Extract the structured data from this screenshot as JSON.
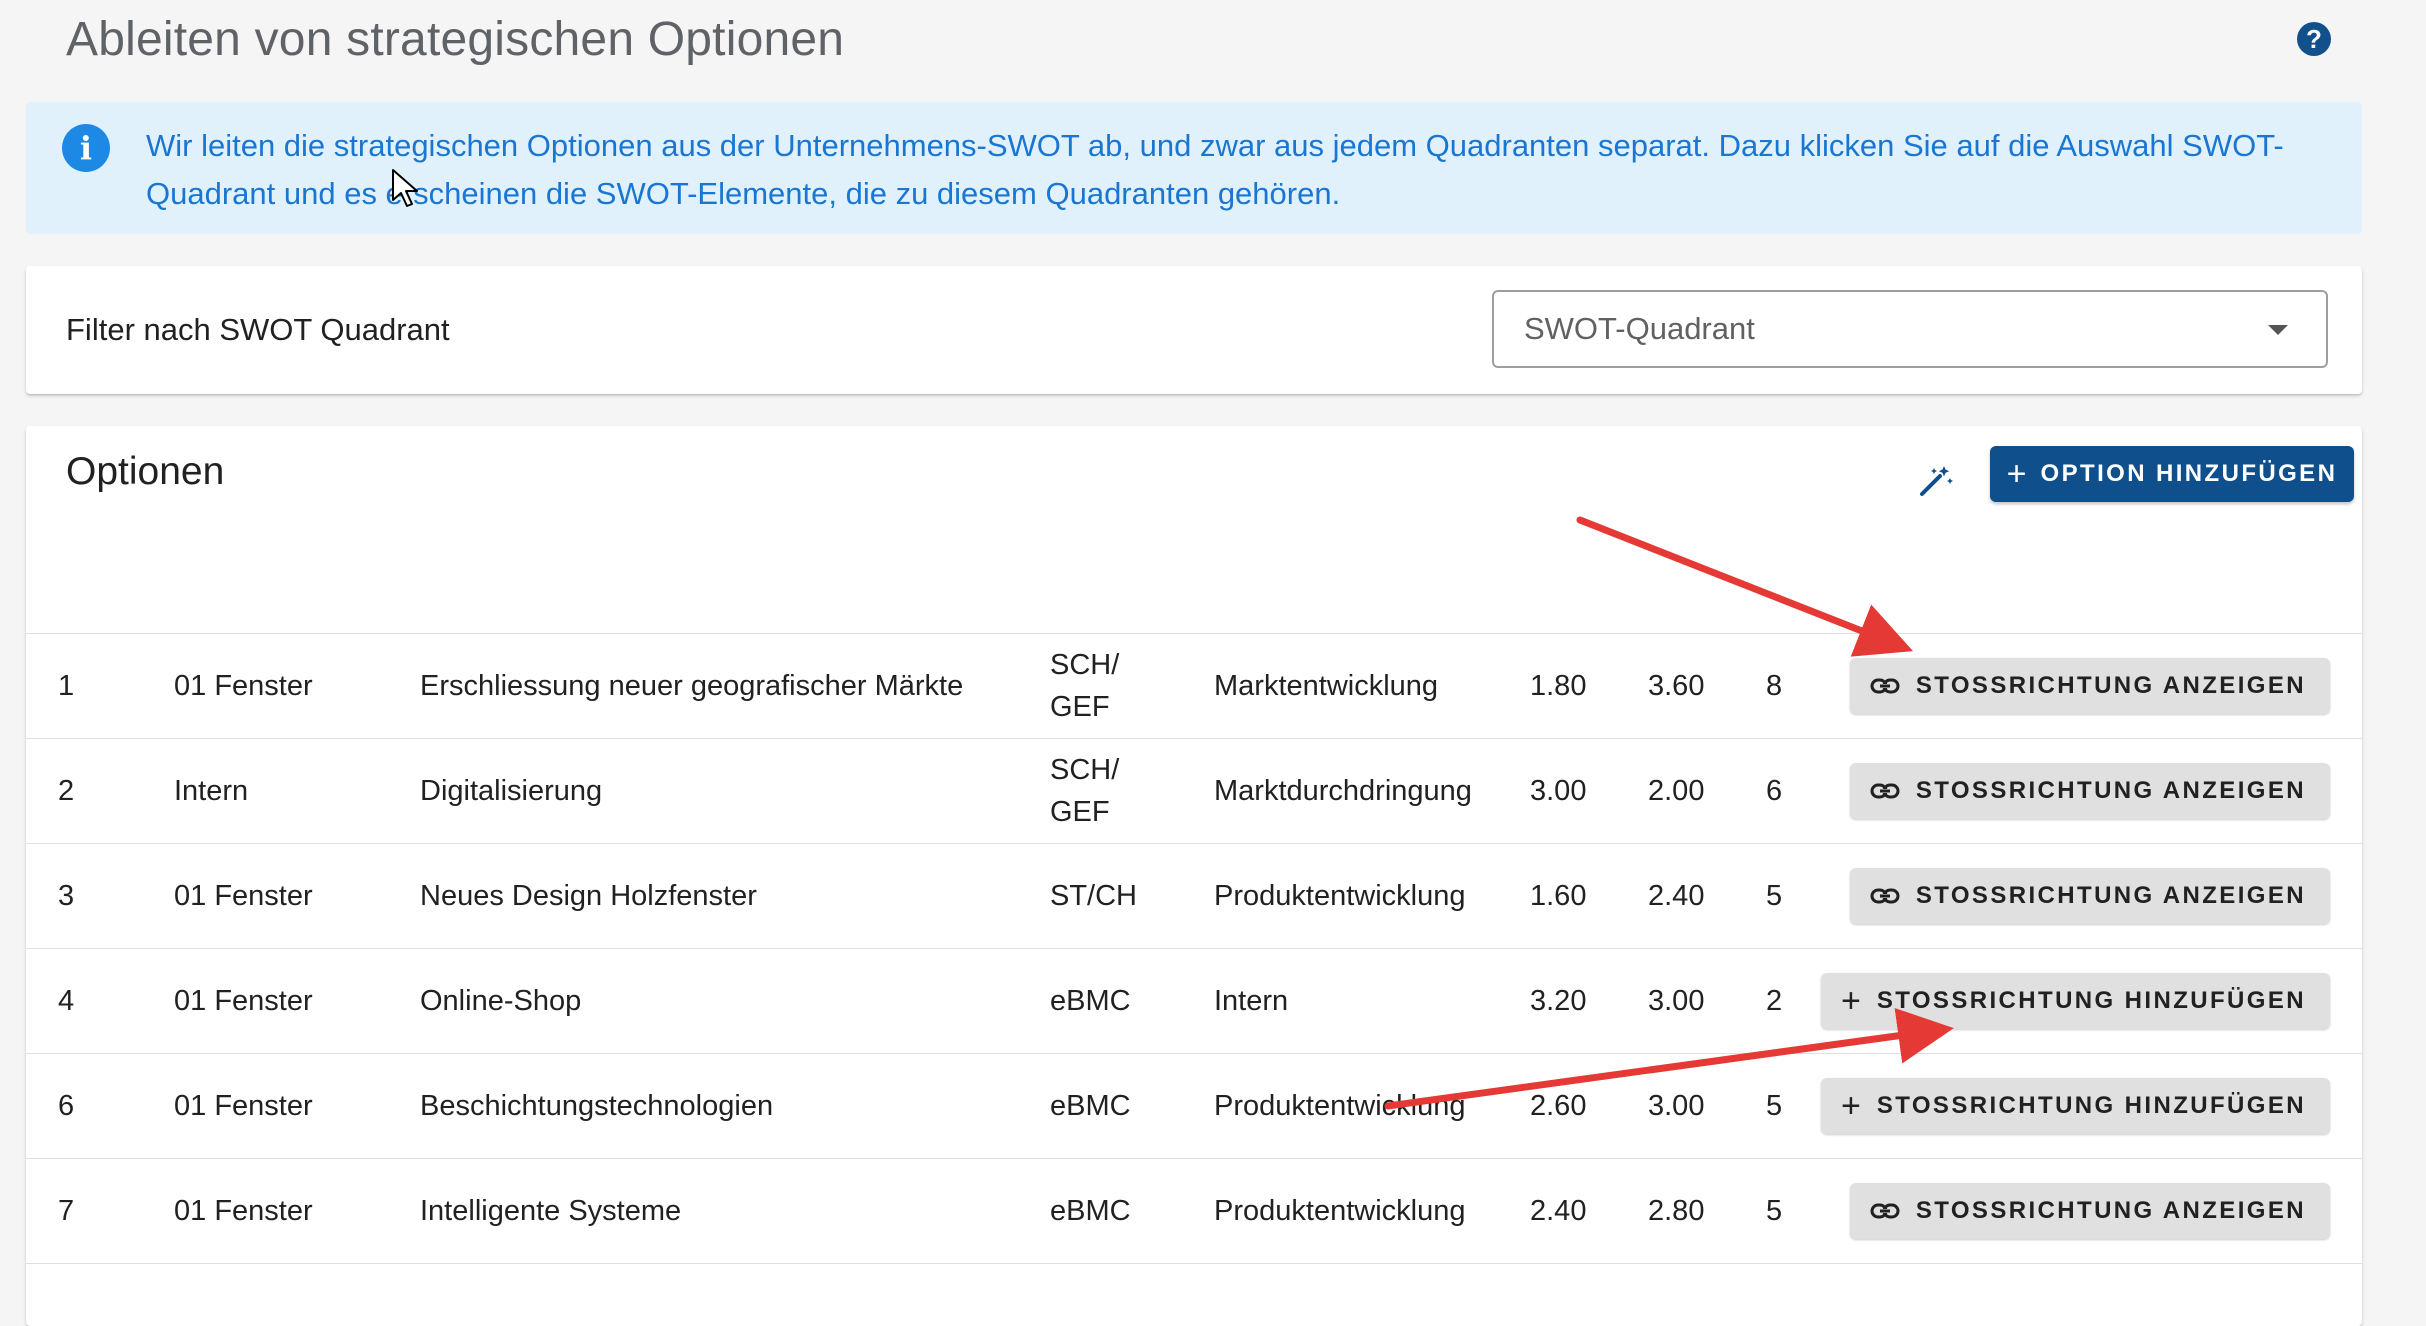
{
  "header": {
    "title": "Ableiten von strategischen Optionen",
    "help_icon": "?"
  },
  "info": {
    "icon": "i",
    "text": "Wir leiten die strategischen Optionen aus der Unternehmens-SWOT ab, und zwar aus jedem Quadranten separat. Dazu klicken Sie auf die Auswahl SWOT-Quadrant und es erscheinen die SWOT-Elemente, die zu diesem Quadranten gehören."
  },
  "filter": {
    "label": "Filter nach SWOT Quadrant",
    "select_value": "SWOT-Quadrant"
  },
  "options": {
    "title": "Optionen",
    "add_button_icon": "+",
    "add_button_label": "OPTION HINZUFÜGEN",
    "rows": [
      {
        "no": "1",
        "area": "01 Fenster",
        "name": "Erschliessung neuer geografischer Märkte",
        "type_line1": "SCH/",
        "type_line2": "GEF",
        "strategy": "Marktentwicklung",
        "v1": "1.80",
        "v2": "3.60",
        "v3": "8",
        "action": "STOSSRICHTUNG ANZEIGEN",
        "action_kind": "show"
      },
      {
        "no": "2",
        "area": "Intern",
        "name": "Digitalisierung",
        "type_line1": "SCH/",
        "type_line2": "GEF",
        "strategy": "Marktdurchdringung",
        "v1": "3.00",
        "v2": "2.00",
        "v3": "6",
        "action": "STOSSRICHTUNG ANZEIGEN",
        "action_kind": "show"
      },
      {
        "no": "3",
        "area": "01 Fenster",
        "name": "Neues Design Holzfenster",
        "type_line1": "ST/CH",
        "type_line2": "",
        "strategy": "Produktentwicklung",
        "v1": "1.60",
        "v2": "2.40",
        "v3": "5",
        "action": "STOSSRICHTUNG ANZEIGEN",
        "action_kind": "show"
      },
      {
        "no": "4",
        "area": "01 Fenster",
        "name": "Online-Shop",
        "type_line1": "eBMC",
        "type_line2": "",
        "strategy": "Intern",
        "v1": "3.20",
        "v2": "3.00",
        "v3": "2",
        "action": "STOSSRICHTUNG HINZUFÜGEN",
        "action_kind": "add"
      },
      {
        "no": "6",
        "area": "01 Fenster",
        "name": "Beschichtungstechnologien",
        "type_line1": "eBMC",
        "type_line2": "",
        "strategy": "Produktentwicklung",
        "v1": "2.60",
        "v2": "3.00",
        "v3": "5",
        "action": "STOSSRICHTUNG HINZUFÜGEN",
        "action_kind": "add"
      },
      {
        "no": "7",
        "area": "01 Fenster",
        "name": "Intelligente Systeme",
        "type_line1": "eBMC",
        "type_line2": "",
        "strategy": "Produktentwicklung",
        "v1": "2.40",
        "v2": "2.80",
        "v3": "5",
        "action": "STOSSRICHTUNG ANZEIGEN",
        "action_kind": "show"
      }
    ]
  },
  "colors": {
    "primary": "#0f4f8c",
    "info_bg": "#e1f1fc",
    "info_text": "#1976d2",
    "annotation_arrow": "#e53935"
  }
}
